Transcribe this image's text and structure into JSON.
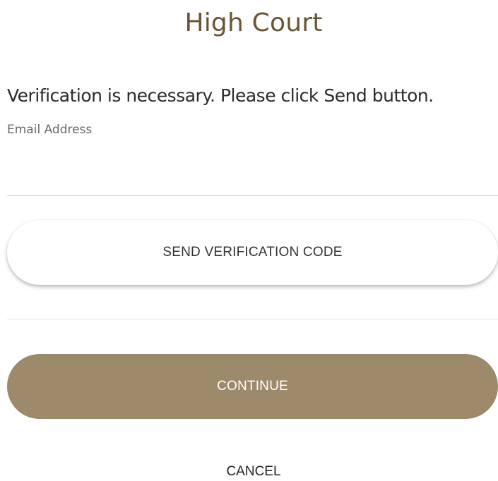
{
  "header": {
    "title": "High Court"
  },
  "form": {
    "intro_text": "Verification is necessary. Please click Send button.",
    "email_label": "Email Address",
    "email_value": "",
    "send_button_label": "SEND VERIFICATION CODE",
    "continue_button_label": "CONTINUE",
    "cancel_label": "CANCEL"
  },
  "colors": {
    "title": "#6b5433",
    "continue_button_bg": "#9c8a6b",
    "send_button_bg": "#ffffff"
  }
}
